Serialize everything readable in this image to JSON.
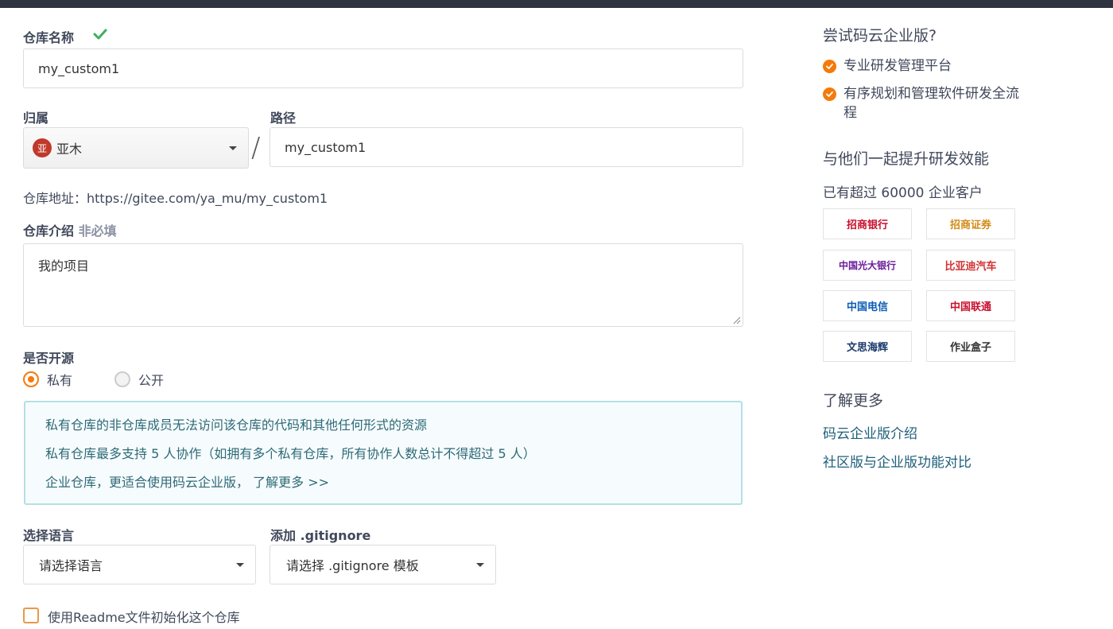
{
  "form": {
    "repo_name_label": "仓库名称",
    "repo_name_value": "my_custom1",
    "owner_label": "归属",
    "owner_avatar_text": "亚",
    "owner_value": "亚木",
    "path_label": "路径",
    "path_value": "my_custom1",
    "repo_address": "仓库地址：https://gitee.com/ya_mu/my_custom1",
    "intro_label": "仓库介绍",
    "intro_optional": "非必填",
    "intro_value": "我的项目",
    "open_source_label": "是否开源",
    "visibility": {
      "options": [
        "私有",
        "公开"
      ],
      "selected": "私有"
    },
    "info_lines": [
      "私有仓库的非仓库成员无法访问该仓库的代码和其他任何形式的资源",
      "私有仓库最多支持 5 人协作（如拥有多个私有仓库，所有协作人数总计不得超过 5 人）",
      "企业仓库，更适合使用码云企业版，"
    ],
    "info_more_link": "了解更多 >>",
    "language_label": "选择语言",
    "language_value": "请选择语言",
    "gitignore_label": "添加 .gitignore",
    "gitignore_value": "请选择 .gitignore 模板",
    "readme_checkbox": {
      "label": "使用Readme文件初始化这个仓库",
      "checked": false
    }
  },
  "sidebar": {
    "try_title": "尝试码云企业版?",
    "features": [
      "专业研发管理平台",
      "有序规划和管理软件研发全流程"
    ],
    "together_title": "与他们一起提升研发效能",
    "customers_text": "已有超过 60000 企业客户",
    "customer_logos": [
      "招商银行",
      "招商证券",
      "中国光大银行",
      "比亚迪汽车",
      "中国电信",
      "中国联通",
      "文思海辉",
      "作业盒子"
    ],
    "learn_more_title": "了解更多",
    "links": [
      "码云企业版介绍",
      "社区版与企业版功能对比"
    ]
  },
  "colors": {
    "accent_orange": "#f57a0b",
    "success_green": "#3eaf5e",
    "info_border": "#b5dfe5",
    "link": "#1e5f7a"
  }
}
